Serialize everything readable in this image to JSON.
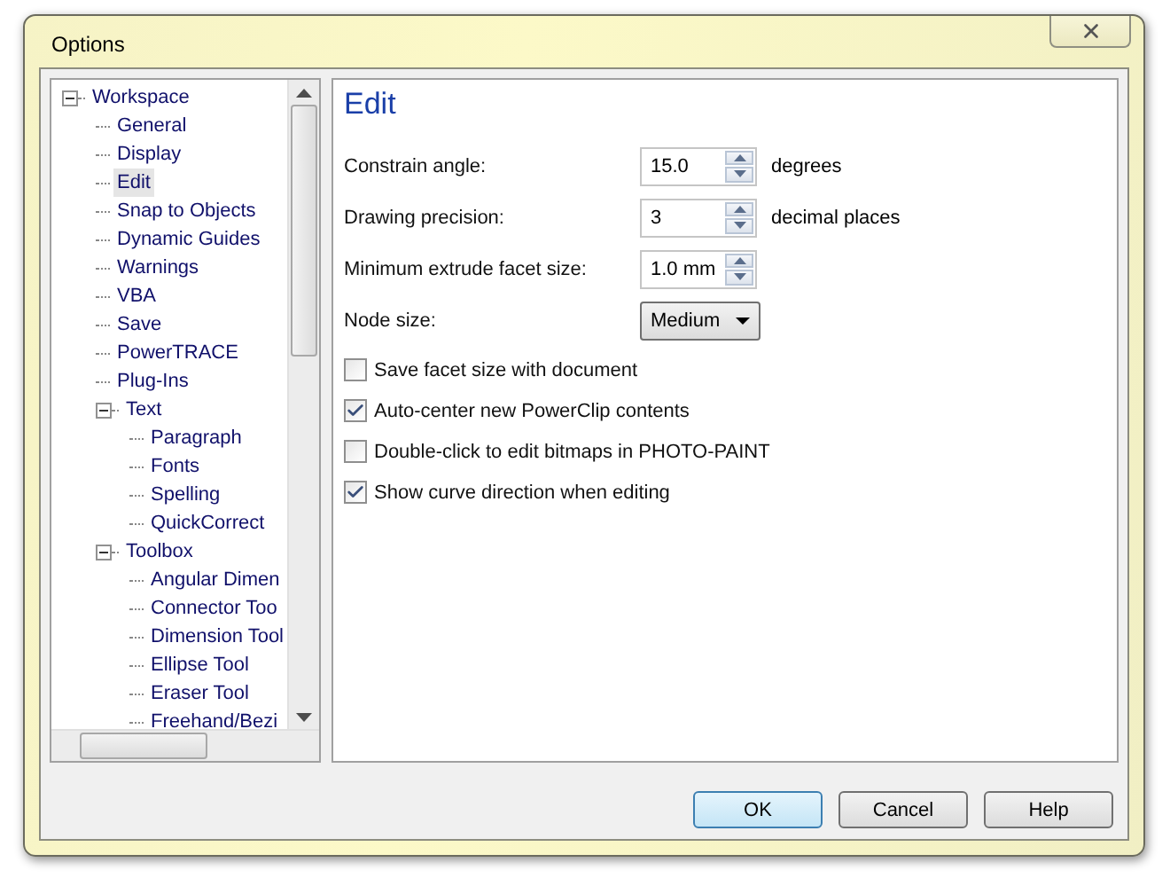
{
  "window": {
    "title": "Options"
  },
  "tree": [
    {
      "label": "Workspace",
      "selected": false,
      "expanded": true,
      "children": [
        {
          "label": "General",
          "selected": false
        },
        {
          "label": "Display",
          "selected": false
        },
        {
          "label": "Edit",
          "selected": true
        },
        {
          "label": "Snap to Objects",
          "selected": false
        },
        {
          "label": "Dynamic Guides",
          "selected": false
        },
        {
          "label": "Warnings",
          "selected": false
        },
        {
          "label": "VBA",
          "selected": false
        },
        {
          "label": "Save",
          "selected": false
        },
        {
          "label": "PowerTRACE",
          "selected": false
        },
        {
          "label": "Plug-Ins",
          "selected": false
        },
        {
          "label": "Text",
          "selected": false,
          "expanded": true,
          "children": [
            {
              "label": "Paragraph",
              "selected": false
            },
            {
              "label": "Fonts",
              "selected": false
            },
            {
              "label": "Spelling",
              "selected": false
            },
            {
              "label": "QuickCorrect",
              "selected": false
            }
          ]
        },
        {
          "label": "Toolbox",
          "selected": false,
          "expanded": true,
          "children": [
            {
              "label": "Angular Dimen",
              "selected": false
            },
            {
              "label": "Connector Too",
              "selected": false
            },
            {
              "label": "Dimension Tool",
              "selected": false
            },
            {
              "label": "Ellipse Tool",
              "selected": false
            },
            {
              "label": "Eraser Tool",
              "selected": false
            },
            {
              "label": "Freehand/Bezi",
              "selected": false
            }
          ]
        }
      ]
    }
  ],
  "panel": {
    "heading": "Edit",
    "fields": [
      {
        "kind": "spinner",
        "label": "Constrain angle:",
        "value": "15.0",
        "unit": "degrees"
      },
      {
        "kind": "spinner",
        "label": "Drawing precision:",
        "value": "3",
        "unit": "decimal places"
      },
      {
        "kind": "spinner",
        "label": "Minimum extrude facet size:",
        "value": "1.0 mm"
      },
      {
        "kind": "dropdown",
        "label": "Node size:",
        "value": "Medium"
      }
    ],
    "checkboxes": [
      {
        "label": "Save facet size with document",
        "checked": false
      },
      {
        "label": "Auto-center new PowerClip contents",
        "checked": true
      },
      {
        "label": "Double-click to edit bitmaps in PHOTO-PAINT",
        "checked": false
      },
      {
        "label": "Show curve direction when editing",
        "checked": true
      }
    ]
  },
  "buttons": [
    {
      "label": "OK",
      "selected": true
    },
    {
      "label": "Cancel",
      "selected": false
    },
    {
      "label": "Help",
      "selected": false
    }
  ]
}
